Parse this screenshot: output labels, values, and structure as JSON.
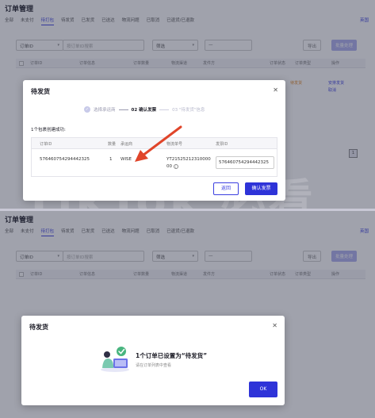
{
  "page": {
    "title": "订单管理",
    "tabs": [
      "全部",
      "未支付",
      "待打包",
      "待发货",
      "已发货",
      "已送达",
      "物流问题",
      "已取消",
      "已退货/已退款"
    ],
    "active_tab": "待打包",
    "right_link": "英国",
    "filters": {
      "order_id_select": "订单ID",
      "order_id_placeholder": "按订单ID搜索",
      "filter3": "筛选",
      "filter4": "—"
    },
    "export_button": "导出",
    "bulk_button": "批量处理",
    "columns": [
      "订单ID",
      "订单信息",
      "订单数量",
      "物流渠道",
      "发件方",
      "订单状态",
      "订单类型",
      "操作"
    ],
    "row_status": "待发货",
    "row_action_1": "安排发货",
    "row_action_2": "取消",
    "page_number": "1"
  },
  "watermark": "TikTok 必看",
  "modal_ship": {
    "title": "待发货",
    "steps": [
      "选择承运商",
      "02 确认发票",
      "03 \"待发货\"信息"
    ],
    "success_note": "1个包裹创建成功:",
    "columns": [
      "订单ID",
      "数量",
      "承运商",
      "物流单号",
      "发票ID"
    ],
    "row": {
      "order_id": "576460754294442325",
      "quantity": "1",
      "carrier": "WISE",
      "tracking": "YT2152521231000000",
      "invoice_id": "576460754294442325"
    },
    "back_button": "返回",
    "confirm_button": "确认发票"
  },
  "modal_done": {
    "title": "待发货",
    "message": "1个订单已设置为“待发货”",
    "sub": "请在订单列表中查看",
    "ok_button": "OK"
  },
  "colors": {
    "accent": "#2e33d8",
    "arrow": "#e0452a",
    "overlay": "#2d3048"
  }
}
